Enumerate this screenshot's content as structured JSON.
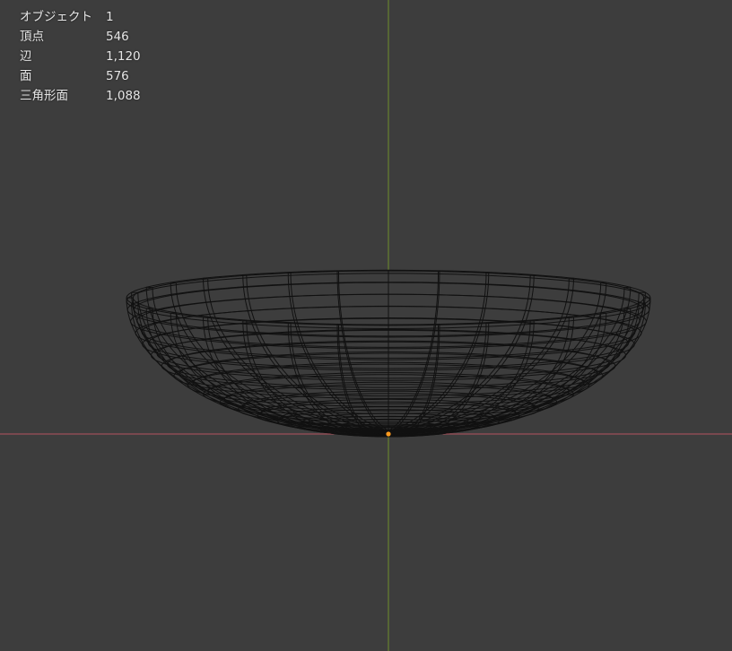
{
  "overlay": {
    "stats": [
      {
        "label": "オブジェクト",
        "value": "1"
      },
      {
        "label": "頂点",
        "value": "546"
      },
      {
        "label": "辺",
        "value": "1,120"
      },
      {
        "label": "面",
        "value": "576"
      },
      {
        "label": "三角形面",
        "value": "1,088"
      }
    ]
  },
  "colors": {
    "background": "#3d3d3d",
    "wire": "#111111",
    "axis_x": "#b5535e",
    "axis_y": "#6e8f2a",
    "origin": "#ff9a1f"
  },
  "mesh": {
    "segments": 32,
    "rings": 18,
    "shape": "bowl",
    "view": "front"
  }
}
